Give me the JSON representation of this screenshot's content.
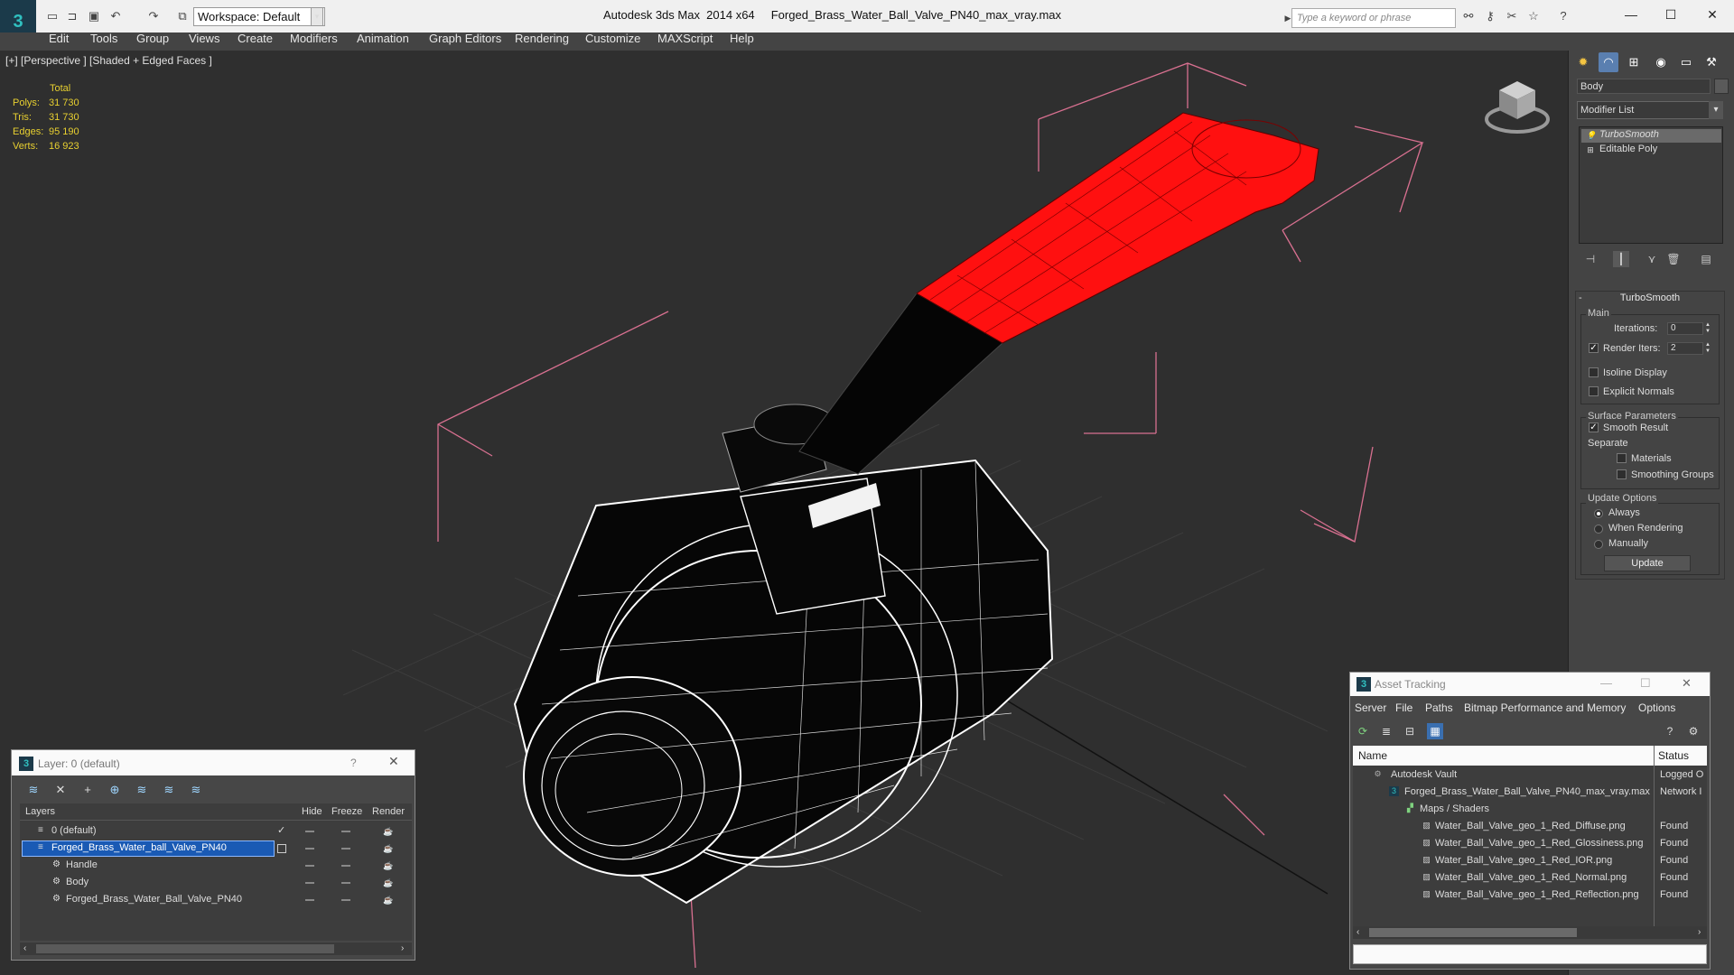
{
  "titlebar": {
    "workspace": "Workspace: Default",
    "app_name": "Autodesk 3ds Max  2014 x64",
    "file_name": "Forged_Brass_Water_Ball_Valve_PN40_max_vray.max",
    "search_placeholder": "Type a keyword or phrase",
    "logo_glyph": "3"
  },
  "menu": [
    "Edit",
    "Tools",
    "Group",
    "Views",
    "Create",
    "Modifiers",
    "Animation",
    "Graph Editors",
    "Rendering",
    "Customize",
    "MAXScript",
    "Help"
  ],
  "viewport": {
    "label": "[+] [Perspective ] [Shaded + Edged Faces ]",
    "stats": {
      "header": "Total",
      "rows": [
        {
          "label": "Polys:",
          "value": "31 730"
        },
        {
          "label": "Tris:",
          "value": "31 730"
        },
        {
          "label": "Edges:",
          "value": "95 190"
        },
        {
          "label": "Verts:",
          "value": "16 923"
        }
      ]
    },
    "colors": {
      "handle": "#ff1010",
      "wire": "#ffffff",
      "bbox": "#d87090",
      "grid": "#3a3a3a",
      "mesh": "#050505"
    }
  },
  "command_panel": {
    "object_name": "Body",
    "modifier_list": "Modifier List",
    "stack": [
      "TurboSmooth",
      "Editable Poly"
    ],
    "turbosmooth": {
      "title": "TurboSmooth",
      "main_group": "Main",
      "iterations_label": "Iterations:",
      "iterations_value": "0",
      "render_iters_label": "Render Iters:",
      "render_iters_value": "2",
      "isoline": "Isoline Display",
      "explicit_normals": "Explicit Normals",
      "surface_group": "Surface Parameters",
      "smooth_result": "Smooth Result",
      "separate": "Separate",
      "materials": "Materials",
      "smoothing_groups": "Smoothing Groups",
      "update_group": "Update Options",
      "always": "Always",
      "when_rendering": "When Rendering",
      "manually": "Manually",
      "update_button": "Update"
    }
  },
  "layer_dialog": {
    "title": "Layer: 0 (default)",
    "help": "?",
    "columns": {
      "layers": "Layers",
      "hide": "Hide",
      "freeze": "Freeze",
      "render": "Render"
    },
    "rows": [
      {
        "name": "0 (default)"
      },
      {
        "name": "Forged_Brass_Water_ball_Valve_PN40"
      },
      {
        "name": "Handle"
      },
      {
        "name": "Body"
      },
      {
        "name": "Forged_Brass_Water_Ball_Valve_PN40"
      }
    ]
  },
  "asset_dialog": {
    "title": "Asset Tracking",
    "menu": [
      "Server",
      "File",
      "Paths",
      "Bitmap Performance and Memory",
      "Options"
    ],
    "columns": {
      "name": "Name",
      "status": "Status"
    },
    "rows": [
      {
        "name": "Autodesk Vault",
        "status": "Logged O"
      },
      {
        "name": "Forged_Brass_Water_Ball_Valve_PN40_max_vray.max",
        "status": "Network I"
      },
      {
        "name": "Maps / Shaders",
        "status": ""
      },
      {
        "name": "Water_Ball_Valve_geo_1_Red_Diffuse.png",
        "status": "Found"
      },
      {
        "name": "Water_Ball_Valve_geo_1_Red_Glossiness.png",
        "status": "Found"
      },
      {
        "name": "Water_Ball_Valve_geo_1_Red_IOR.png",
        "status": "Found"
      },
      {
        "name": "Water_Ball_Valve_geo_1_Red_Normal.png",
        "status": "Found"
      },
      {
        "name": "Water_Ball_Valve_geo_1_Red_Reflection.png",
        "status": "Found"
      }
    ]
  }
}
